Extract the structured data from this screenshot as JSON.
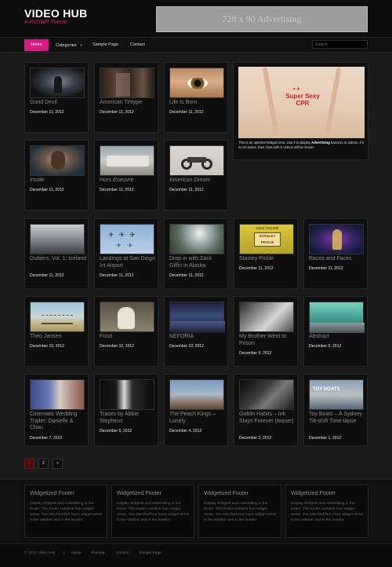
{
  "header": {
    "logo": "VIDEO HUB",
    "tagline": "A RichWP Theme",
    "ad": "728 x 90 Advertising"
  },
  "nav": {
    "items": [
      {
        "label": "Home",
        "active": true
      },
      {
        "label": "Categories",
        "has_dropdown": true
      },
      {
        "label": "Sample Page"
      },
      {
        "label": "Contact"
      }
    ],
    "search_placeholder": "Search"
  },
  "posts": [
    {
      "title": "Good Devil",
      "date": "December 11, 2012"
    },
    {
      "title": "American Tintype",
      "date": "December 11, 2012"
    },
    {
      "title": "Life Is Born",
      "date": "December 11, 2012"
    },
    {
      "title": "Inside",
      "date": "December 11, 2012"
    },
    {
      "title": "Hors d'oeuvre",
      "date": "December 11, 2012"
    },
    {
      "title": "American Dream",
      "date": "December 11, 2012"
    },
    {
      "title": "Outliers, Vol. 1: Iceland",
      "date": "December 11, 2012"
    },
    {
      "title": "Landings at San Diego Int Airport",
      "date": "December 11, 2012"
    },
    {
      "title": "Drop in with Zack Giffin in Alaska",
      "date": "December 11, 2012"
    },
    {
      "title": "Stanley Pickle",
      "date": "December 11, 2012"
    },
    {
      "title": "Races and Faces",
      "date": "December 11, 2012"
    },
    {
      "title": "Theo Jansen",
      "date": "December 10, 2012"
    },
    {
      "title": "Food",
      "date": "December 10, 2012"
    },
    {
      "title": "NEFORIA",
      "date": "December 10, 2012"
    },
    {
      "title": "My Brother Went to Prison",
      "date": "December 9, 2012"
    },
    {
      "title": "Abstract",
      "date": "December 9, 2012"
    },
    {
      "title": "Cinematic Wedding Trailer: Danielle & Chau",
      "date": "December 7, 2012"
    },
    {
      "title": "Traces by Abbie Stephens",
      "date": "December 6, 2012"
    },
    {
      "title": "The Peach Kings – Lonely",
      "date": "December 4, 2012"
    },
    {
      "title": "Goblin Habits – Ink Stays Forever (teaser)",
      "date": "December 2, 2012"
    },
    {
      "title": "Toy Boats – A Sydney Tilt-shift Time-lapse",
      "date": "December 1, 2012"
    }
  ],
  "widget": {
    "image_title_line1": "Super Sexy",
    "image_title_line2": "CPR",
    "text_before": "This is an optional Widget Area. Use it to display ",
    "text_bold": "Advertising",
    "text_after": " banners or videos. If it is not active, then rows with 5 videos will be shown."
  },
  "thumb_texts": {
    "stanley_top": "NOW ONLINE",
    "stanley_name": "STANLEY PICKLE",
    "toy_boats": "TOY BOATS"
  },
  "pagination": [
    "1",
    "2",
    "»"
  ],
  "footer_widgets": [
    {
      "title": "Widgetized Footer",
      "text": "Display Widgets and Advertising in the footer. This footer contains four widget areas. You also find four more widget areas in the sidebar and in the header."
    },
    {
      "title": "Widgetized Footer",
      "text": "Display Widgets and Advertising in the footer. This footer contains four widget areas. You also find four more widget areas in the sidebar and in the header."
    },
    {
      "title": "Widgetized Footer",
      "text": "Display Widgets and Advertising in the footer. This footer contains four widget areas. You also find four more widget areas in the sidebar and in the header."
    },
    {
      "title": "Widgetized Footer",
      "text": "Display Widgets and Advertising in the footer. This footer contains four widget areas. You also find four more widget areas in the sidebar and in the header."
    }
  ],
  "bottom_bar": {
    "copyright": "© 2012 Video Hub",
    "links": [
      "Home",
      "Sitemap",
      "Contact",
      "Sample Page"
    ]
  },
  "colors": {
    "accent": "#d61c83",
    "background": "#1b1b1b"
  }
}
